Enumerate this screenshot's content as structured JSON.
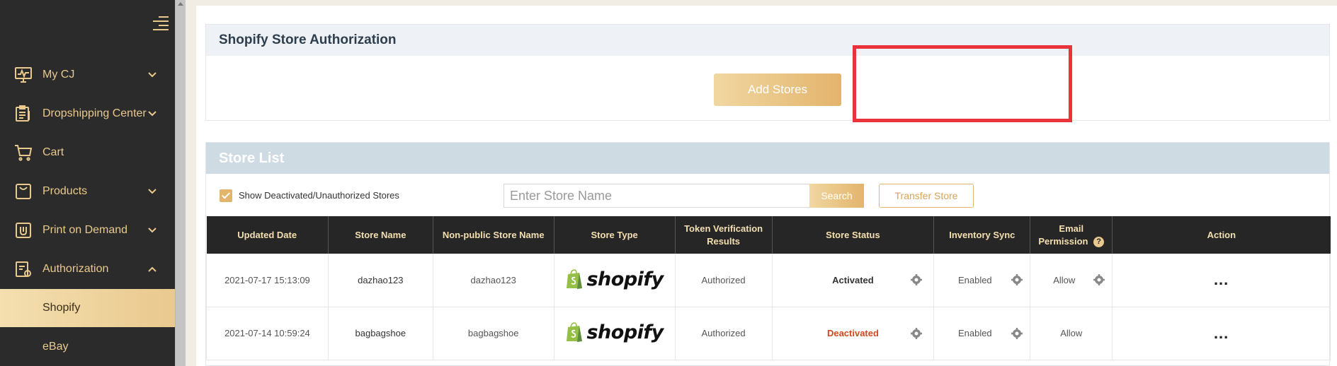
{
  "sidebar": {
    "items": [
      {
        "label": "My CJ",
        "icon": "monitor-chart-icon",
        "chevron": "down"
      },
      {
        "label": "Dropshipping Center",
        "icon": "clipboard-icon",
        "chevron": "down"
      },
      {
        "label": "Cart",
        "icon": "cart-icon",
        "chevron": ""
      },
      {
        "label": "Products",
        "icon": "box-icon",
        "chevron": "down"
      },
      {
        "label": "Print on Demand",
        "icon": "print-on-demand-icon",
        "chevron": "down"
      },
      {
        "label": "Authorization",
        "icon": "authorization-icon",
        "chevron": "up"
      },
      {
        "label": "Shopify",
        "icon": "",
        "chevron": "",
        "active": true
      },
      {
        "label": "eBay",
        "icon": "",
        "chevron": ""
      }
    ]
  },
  "auth": {
    "title": "Shopify Store Authorization",
    "add_button": "Add Stores"
  },
  "store_list": {
    "title": "Store List",
    "show_deactivated_label": "Show Deactivated/Unauthorized Stores",
    "search_placeholder": "Enter Store Name",
    "search_button": "Search",
    "transfer_button": "Transfer Store",
    "columns": {
      "updated_date": "Updated Date",
      "store_name": "Store Name",
      "non_public_name": "Non-public Store Name",
      "store_type": "Store Type",
      "token_line1": "Token Verification",
      "token_line2": "Results",
      "store_status": "Store Status",
      "inventory_sync": "Inventory Sync",
      "email_line1": "Email",
      "email_line2": "Permission",
      "action": "Action"
    },
    "rows": [
      {
        "updated": "2021-07-17 15:13:09",
        "store_name": "dazhao123",
        "non_public": "dazhao123",
        "type": "shopify",
        "token": "Authorized",
        "status": "Activated",
        "inventory": "Enabled",
        "email": "Allow",
        "action": "..."
      },
      {
        "updated": "2021-07-14 10:59:24",
        "store_name": "bagbagshoe",
        "non_public": "bagbagshoe",
        "type": "shopify",
        "token": "Authorized",
        "status": "Deactivated",
        "inventory": "Enabled",
        "email": "Allow",
        "action": "..."
      }
    ]
  },
  "colors": {
    "sidebar_bg": "#2b2b2b",
    "accent_gold": "#e3b46c",
    "highlight_red": "#e8333a",
    "deactivated_red": "#d4471b"
  }
}
